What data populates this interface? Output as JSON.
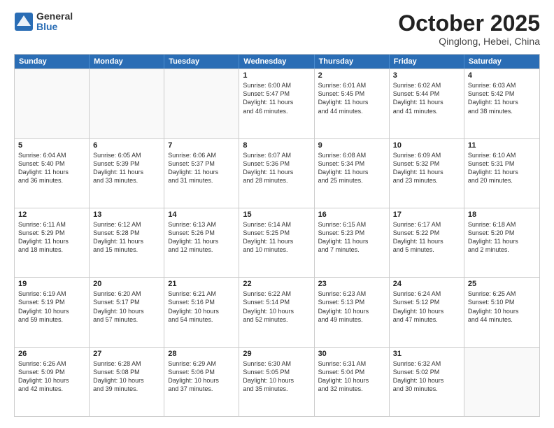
{
  "logo": {
    "general": "General",
    "blue": "Blue"
  },
  "header": {
    "month": "October 2025",
    "location": "Qinglong, Hebei, China"
  },
  "days": [
    "Sunday",
    "Monday",
    "Tuesday",
    "Wednesday",
    "Thursday",
    "Friday",
    "Saturday"
  ],
  "weeks": [
    [
      {
        "day": "",
        "text": ""
      },
      {
        "day": "",
        "text": ""
      },
      {
        "day": "",
        "text": ""
      },
      {
        "day": "1",
        "text": "Sunrise: 6:00 AM\nSunset: 5:47 PM\nDaylight: 11 hours\nand 46 minutes."
      },
      {
        "day": "2",
        "text": "Sunrise: 6:01 AM\nSunset: 5:45 PM\nDaylight: 11 hours\nand 44 minutes."
      },
      {
        "day": "3",
        "text": "Sunrise: 6:02 AM\nSunset: 5:44 PM\nDaylight: 11 hours\nand 41 minutes."
      },
      {
        "day": "4",
        "text": "Sunrise: 6:03 AM\nSunset: 5:42 PM\nDaylight: 11 hours\nand 38 minutes."
      }
    ],
    [
      {
        "day": "5",
        "text": "Sunrise: 6:04 AM\nSunset: 5:40 PM\nDaylight: 11 hours\nand 36 minutes."
      },
      {
        "day": "6",
        "text": "Sunrise: 6:05 AM\nSunset: 5:39 PM\nDaylight: 11 hours\nand 33 minutes."
      },
      {
        "day": "7",
        "text": "Sunrise: 6:06 AM\nSunset: 5:37 PM\nDaylight: 11 hours\nand 31 minutes."
      },
      {
        "day": "8",
        "text": "Sunrise: 6:07 AM\nSunset: 5:36 PM\nDaylight: 11 hours\nand 28 minutes."
      },
      {
        "day": "9",
        "text": "Sunrise: 6:08 AM\nSunset: 5:34 PM\nDaylight: 11 hours\nand 25 minutes."
      },
      {
        "day": "10",
        "text": "Sunrise: 6:09 AM\nSunset: 5:32 PM\nDaylight: 11 hours\nand 23 minutes."
      },
      {
        "day": "11",
        "text": "Sunrise: 6:10 AM\nSunset: 5:31 PM\nDaylight: 11 hours\nand 20 minutes."
      }
    ],
    [
      {
        "day": "12",
        "text": "Sunrise: 6:11 AM\nSunset: 5:29 PM\nDaylight: 11 hours\nand 18 minutes."
      },
      {
        "day": "13",
        "text": "Sunrise: 6:12 AM\nSunset: 5:28 PM\nDaylight: 11 hours\nand 15 minutes."
      },
      {
        "day": "14",
        "text": "Sunrise: 6:13 AM\nSunset: 5:26 PM\nDaylight: 11 hours\nand 12 minutes."
      },
      {
        "day": "15",
        "text": "Sunrise: 6:14 AM\nSunset: 5:25 PM\nDaylight: 11 hours\nand 10 minutes."
      },
      {
        "day": "16",
        "text": "Sunrise: 6:15 AM\nSunset: 5:23 PM\nDaylight: 11 hours\nand 7 minutes."
      },
      {
        "day": "17",
        "text": "Sunrise: 6:17 AM\nSunset: 5:22 PM\nDaylight: 11 hours\nand 5 minutes."
      },
      {
        "day": "18",
        "text": "Sunrise: 6:18 AM\nSunset: 5:20 PM\nDaylight: 11 hours\nand 2 minutes."
      }
    ],
    [
      {
        "day": "19",
        "text": "Sunrise: 6:19 AM\nSunset: 5:19 PM\nDaylight: 10 hours\nand 59 minutes."
      },
      {
        "day": "20",
        "text": "Sunrise: 6:20 AM\nSunset: 5:17 PM\nDaylight: 10 hours\nand 57 minutes."
      },
      {
        "day": "21",
        "text": "Sunrise: 6:21 AM\nSunset: 5:16 PM\nDaylight: 10 hours\nand 54 minutes."
      },
      {
        "day": "22",
        "text": "Sunrise: 6:22 AM\nSunset: 5:14 PM\nDaylight: 10 hours\nand 52 minutes."
      },
      {
        "day": "23",
        "text": "Sunrise: 6:23 AM\nSunset: 5:13 PM\nDaylight: 10 hours\nand 49 minutes."
      },
      {
        "day": "24",
        "text": "Sunrise: 6:24 AM\nSunset: 5:12 PM\nDaylight: 10 hours\nand 47 minutes."
      },
      {
        "day": "25",
        "text": "Sunrise: 6:25 AM\nSunset: 5:10 PM\nDaylight: 10 hours\nand 44 minutes."
      }
    ],
    [
      {
        "day": "26",
        "text": "Sunrise: 6:26 AM\nSunset: 5:09 PM\nDaylight: 10 hours\nand 42 minutes."
      },
      {
        "day": "27",
        "text": "Sunrise: 6:28 AM\nSunset: 5:08 PM\nDaylight: 10 hours\nand 39 minutes."
      },
      {
        "day": "28",
        "text": "Sunrise: 6:29 AM\nSunset: 5:06 PM\nDaylight: 10 hours\nand 37 minutes."
      },
      {
        "day": "29",
        "text": "Sunrise: 6:30 AM\nSunset: 5:05 PM\nDaylight: 10 hours\nand 35 minutes."
      },
      {
        "day": "30",
        "text": "Sunrise: 6:31 AM\nSunset: 5:04 PM\nDaylight: 10 hours\nand 32 minutes."
      },
      {
        "day": "31",
        "text": "Sunrise: 6:32 AM\nSunset: 5:02 PM\nDaylight: 10 hours\nand 30 minutes."
      },
      {
        "day": "",
        "text": ""
      }
    ]
  ]
}
